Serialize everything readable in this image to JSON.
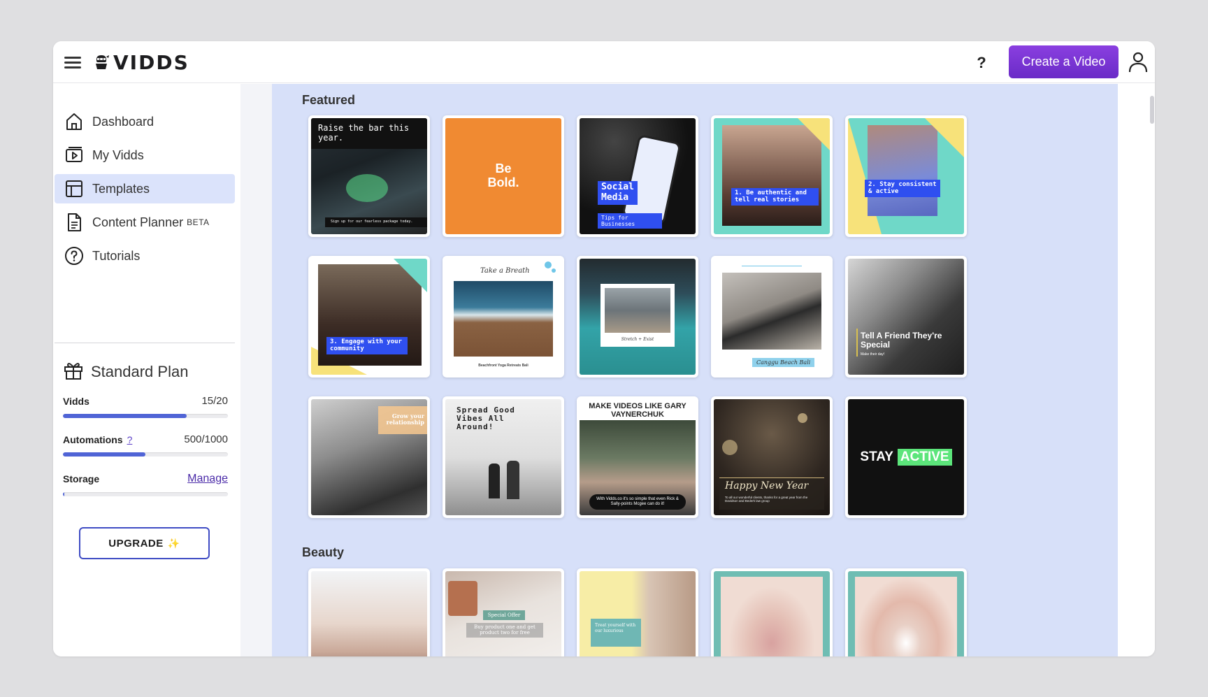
{
  "app": {
    "brand": "VIDDS"
  },
  "header": {
    "help_label": "?",
    "create_label": "Create a Video"
  },
  "sidebar": {
    "items": [
      {
        "label": "Dashboard",
        "icon": "home-icon"
      },
      {
        "label": "My Vidds",
        "icon": "video-library-icon"
      },
      {
        "label": "Templates",
        "icon": "templates-icon",
        "active": true
      },
      {
        "label": "Content Planner",
        "badge": "BETA",
        "icon": "document-icon"
      },
      {
        "label": "Tutorials",
        "icon": "help-circle-icon"
      }
    ],
    "plan": {
      "title": "Standard Plan",
      "vidds": {
        "label": "Vidds",
        "value": "15/20",
        "fraction": 0.75
      },
      "automations": {
        "label": "Automations",
        "help": "?",
        "value": "500/1000",
        "fraction": 0.5
      },
      "storage": {
        "label": "Storage",
        "link": "Manage",
        "fraction": 0.01
      },
      "upgrade_label": "UPGRADE"
    }
  },
  "sections": [
    {
      "title": "Featured",
      "cards": [
        {
          "text": "Raise the bar this year.",
          "sub": "Sign up for our fearless package today."
        },
        {
          "text": "Be\nBold."
        },
        {
          "text": "Social\nMedia",
          "sub": "Tips for Businesses"
        },
        {
          "text": "1. Be authentic and tell real stories"
        },
        {
          "text": "2. Stay consistent & active"
        },
        {
          "text": "3. Engage with your community"
        },
        {
          "text": "Take a Breath",
          "sub": "Beachfront Yoga Retreats Bali"
        },
        {
          "text": "Stretch + Exist"
        },
        {
          "text": "Canggu Beach Bali"
        },
        {
          "text": "Tell A Friend They're Special",
          "sub": "Make their day!"
        },
        {
          "text": "Grow your relationship"
        },
        {
          "text": "Spread Good Vibes All Around!"
        },
        {
          "text": "MAKE VIDEOS LIKE GARY VAYNERCHUK",
          "sub": "With Vidds.co it's so simple that even Rick & Sally-points Mcgee can do it!"
        },
        {
          "text": "Happy New Year",
          "sub": "To all our wonderful clients, thanks for a great year from the Davidson and Bederk law group"
        },
        {
          "text": "STAY",
          "accent": "ACTIVE"
        }
      ]
    },
    {
      "title": "Beauty",
      "cards": [
        {
          "text": ""
        },
        {
          "text": "Special Offer",
          "sub": "Buy product one and get product two for free"
        },
        {
          "text": "Treat yourself with our luxurious"
        },
        {
          "text": ""
        },
        {
          "text": ""
        }
      ]
    }
  ],
  "colors": {
    "accent": "#7b35d6",
    "main_bg": "#d7e0f9",
    "progress": "#5064d6",
    "upgrade_border": "#3f4cc4"
  }
}
